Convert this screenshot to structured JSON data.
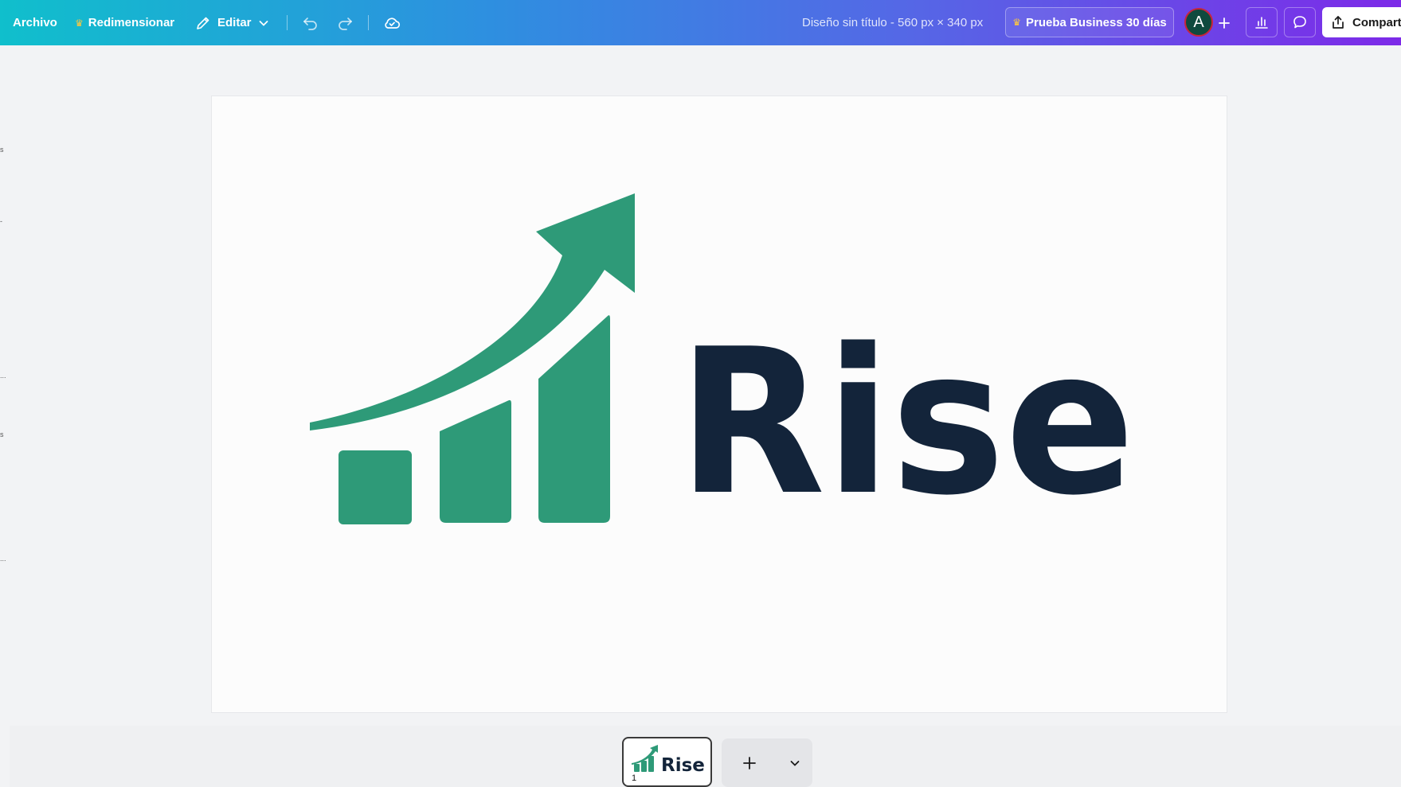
{
  "topbar": {
    "file_label": "Archivo",
    "resize_label": "Redimensionar",
    "edit_label": "Editar",
    "document_title": "Diseño sin título - 560 px × 340 px",
    "trial_label": "Prueba Business 30 días",
    "avatar_initial": "A",
    "share_label": "Compartir",
    "crown_icon": "crown-icon",
    "gradient_colors": [
      "#10bfcc",
      "#2e8fe0",
      "#5567e6",
      "#7d2ae8"
    ]
  },
  "left_hints": [
    "s",
    "-",
    "...",
    "s",
    "..."
  ],
  "canvas": {
    "logo_text": "Rise",
    "brand_green": "#2e9a78",
    "brand_navy": "#13243a",
    "background": "#fcfcfc"
  },
  "pages": {
    "thumbnail_text": "Rise",
    "page_number": "1",
    "add_icon": "plus-icon",
    "more_icon": "chevron-down-icon"
  }
}
